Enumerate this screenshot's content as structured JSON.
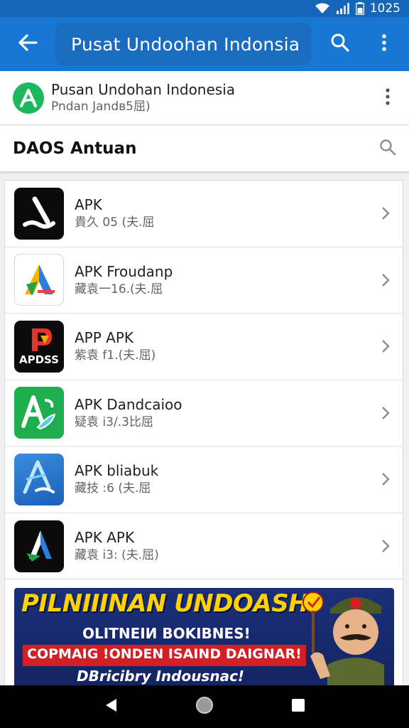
{
  "status": {
    "time": "1025"
  },
  "appbar": {
    "title": "Pusat Undoohan Indonsia"
  },
  "site": {
    "title": "Pusan Undohan Indonesia",
    "subtitle": "Pndan Jandв​5屈)"
  },
  "section": {
    "title": "DAOS Antuan"
  },
  "items": [
    {
      "name": "APK",
      "meta": "貴久 05 (夫.屈",
      "icon": "apk-black-icon"
    },
    {
      "name": "APK Froudanp",
      "meta": "藏袁一16.(夫.屈",
      "icon": "apk-triangle-icon"
    },
    {
      "name": "APP APK",
      "meta": "紫袁 f1.(夫.屈)",
      "icon": "apdss-icon"
    },
    {
      "name": "APK Dandcaioo",
      "meta": "疑袁 i3/.3比屈",
      "icon": "apk-green-icon"
    },
    {
      "name": "APK bliabuk",
      "meta": "藏技 :6 (夫.屈",
      "icon": "apk-blue-icon"
    },
    {
      "name": "APK APK",
      "meta": "藏袁 i3: (夫.屈)",
      "icon": "apk-dark-icon"
    }
  ],
  "banner": {
    "line1": "PILNIIINAN UNDOASH!",
    "line2": "OLITNEIИ BOKIBNES!",
    "line3": "COPMAIG !ONDEN  ISAIND DAIGNAR!",
    "line4": "DBricibry Indousnac!"
  },
  "colors": {
    "appbar": "#1877d2",
    "status": "#1565b8",
    "accent_green": "#1db85c",
    "banner_bg": "#1b2f7a",
    "banner_yellow": "#ffd200",
    "banner_red": "#d41f26"
  }
}
